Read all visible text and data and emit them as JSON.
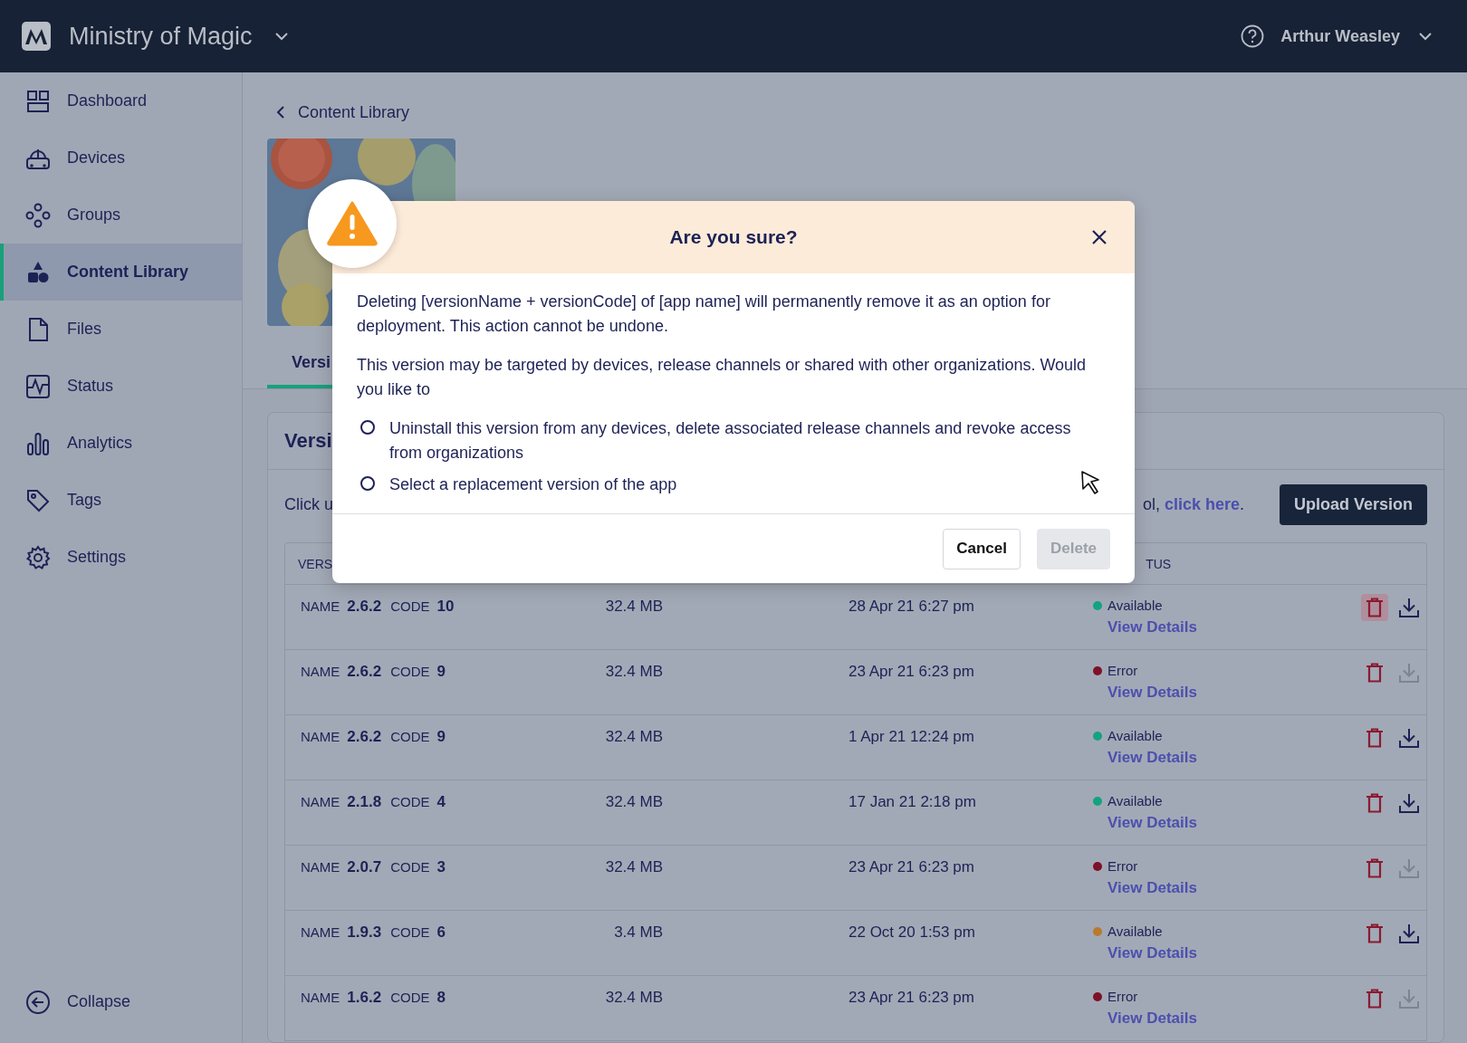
{
  "header": {
    "org_name": "Ministry of Magic",
    "user_name": "Arthur Weasley"
  },
  "sidebar": {
    "items": [
      {
        "label": "Dashboard",
        "selected": false
      },
      {
        "label": "Devices",
        "selected": false
      },
      {
        "label": "Groups",
        "selected": false
      },
      {
        "label": "Content Library",
        "selected": true
      },
      {
        "label": "Files",
        "selected": false
      },
      {
        "label": "Status",
        "selected": false
      },
      {
        "label": "Analytics",
        "selected": false
      },
      {
        "label": "Tags",
        "selected": false
      },
      {
        "label": "Settings",
        "selected": false
      }
    ],
    "collapse_label": "Collapse"
  },
  "breadcrumb": {
    "back_label": "Content Library"
  },
  "tabs": [
    {
      "label": "Versi",
      "selected": true
    }
  ],
  "card": {
    "title": "Versi",
    "intro_start": "Click u",
    "intro_end": "ol, ",
    "intro_link": "click here",
    "intro_after": ".",
    "upload_button": "Upload Version"
  },
  "table": {
    "columns": [
      "VERS",
      "TUS"
    ],
    "rows": [
      {
        "name_label": "NAME",
        "name": "2.6.2",
        "code_label": "CODE",
        "code": "10",
        "size": "32.4 MB",
        "date": "28 Apr 21 6:27 pm",
        "status": "Available",
        "color": "#14a37f",
        "link": "View Details",
        "download_enabled": true,
        "delete_highlighted": true
      },
      {
        "name_label": "NAME",
        "name": "2.6.2",
        "code_label": "CODE",
        "code": "9",
        "size": "32.4 MB",
        "date": "23 Apr 21 6:23 pm",
        "status": "Error",
        "color": "#7d1126",
        "link": "View Details",
        "download_enabled": false,
        "delete_highlighted": false
      },
      {
        "name_label": "NAME",
        "name": "2.6.2",
        "code_label": "CODE",
        "code": "9",
        "size": "32.4 MB",
        "date": "1 Apr 21 12:24 pm",
        "status": "Available",
        "color": "#14a37f",
        "link": "View Details",
        "download_enabled": true,
        "delete_highlighted": false
      },
      {
        "name_label": "NAME",
        "name": "2.1.8",
        "code_label": "CODE",
        "code": "4",
        "size": "32.4 MB",
        "date": "17 Jan 21 2:18 pm",
        "status": "Available",
        "color": "#14a37f",
        "link": "View Details",
        "download_enabled": true,
        "delete_highlighted": false
      },
      {
        "name_label": "NAME",
        "name": "2.0.7",
        "code_label": "CODE",
        "code": "3",
        "size": "32.4 MB",
        "date": "23 Apr 21 6:23 pm",
        "status": "Error",
        "color": "#7d1126",
        "link": "View Details",
        "download_enabled": false,
        "delete_highlighted": false
      },
      {
        "name_label": "NAME",
        "name": "1.9.3",
        "code_label": "CODE",
        "code": "6",
        "size": "3.4 MB",
        "date": "22 Oct 20 1:53 pm",
        "status": "Available",
        "color": "#b97a2c",
        "link": "View Details",
        "download_enabled": true,
        "delete_highlighted": false
      },
      {
        "name_label": "NAME",
        "name": "1.6.2",
        "code_label": "CODE",
        "code": "8",
        "size": "32.4 MB",
        "date": "23 Apr 21 6:23 pm",
        "status": "Error",
        "color": "#7d1126",
        "link": "View Details",
        "download_enabled": false,
        "delete_highlighted": false
      }
    ]
  },
  "dialog": {
    "title": "Are you sure?",
    "paragraphs": [
      "Deleting [versionName + versionCode] of [app name] will permanently remove it as an option for deployment. This action cannot be undone.",
      "This version may be targeted by devices, release channels or shared with other organizations. Would you like to"
    ],
    "options": [
      {
        "label": "Uninstall this version from any devices, delete associated release channels and revoke access from organizations",
        "selected": false
      },
      {
        "label": "Select a replacement version of the app",
        "selected": false
      }
    ],
    "buttons": [
      {
        "label": "Cancel",
        "disabled": false
      },
      {
        "label": "Delete",
        "disabled": true
      }
    ]
  }
}
